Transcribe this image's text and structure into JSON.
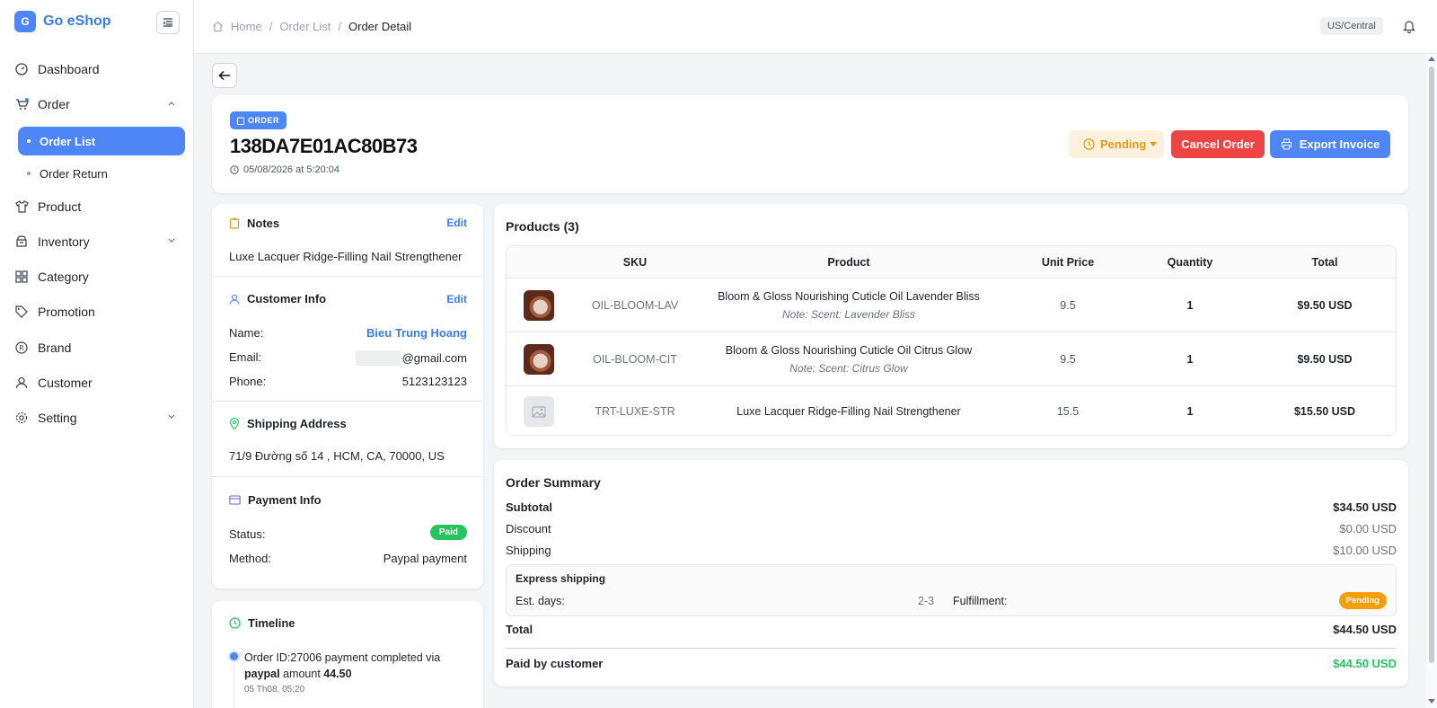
{
  "sidebar": {
    "logo_letter": "G",
    "brand_name": "Go eShop",
    "items": [
      {
        "label": "Dashboard",
        "icon": "dashboard-icon"
      },
      {
        "label": "Order",
        "icon": "cart-icon",
        "expanded": true
      },
      {
        "label": "Product",
        "icon": "shirt-icon"
      },
      {
        "label": "Inventory",
        "icon": "inventory-icon"
      },
      {
        "label": "Category",
        "icon": "grid-icon"
      },
      {
        "label": "Promotion",
        "icon": "tag-icon"
      },
      {
        "label": "Brand",
        "icon": "registered-icon"
      },
      {
        "label": "Customer",
        "icon": "user-icon"
      },
      {
        "label": "Setting",
        "icon": "gear-icon"
      }
    ],
    "order_sub": [
      {
        "label": "Order List",
        "active": true
      },
      {
        "label": "Order Return",
        "active": false
      }
    ]
  },
  "topbar": {
    "breadcrumb": [
      "Home",
      "Order List",
      "Order Detail"
    ],
    "timezone": "US/Central"
  },
  "order": {
    "badge": "ORDER",
    "id": "138DA7E01AC80B73",
    "date": "05/08/2026 at 5:20:04",
    "status": "Pending",
    "cancel_label": "Cancel Order",
    "export_label": "Export Invoice"
  },
  "notes": {
    "title": "Notes",
    "edit": "Edit",
    "text": "Luxe Lacquer Ridge-Filling Nail Strengthener"
  },
  "customer": {
    "title": "Customer Info",
    "edit": "Edit",
    "name_label": "Name:",
    "name": "Bieu Trung Hoang",
    "email_label": "Email:",
    "email": "@gmail.com",
    "phone_label": "Phone:",
    "phone": "5123123123"
  },
  "shipping": {
    "title": "Shipping Address",
    "address": "71/9 Đường số 14 , HCM, CA, 70000, US"
  },
  "payment": {
    "title": "Payment Info",
    "status_label": "Status:",
    "status": "Paid",
    "method_label": "Method:",
    "method": "Paypal payment"
  },
  "timeline": {
    "title": "Timeline",
    "event_prefix": "Order ID:27006 payment completed via",
    "event_method": "paypal",
    "event_amount_label": "amount",
    "event_amount": "44.50",
    "event_time": "05 Th08, 05:20"
  },
  "products": {
    "title": "Products (3)",
    "columns": [
      "SKU",
      "Product",
      "Unit Price",
      "Quantity",
      "Total"
    ],
    "rows": [
      {
        "sku": "OIL-BLOOM-LAV",
        "name": "Bloom & Gloss Nourishing Cuticle Oil Lavender Bliss",
        "note": "Note: Scent: Lavender Bliss",
        "price": "9.5",
        "qty": "1",
        "total": "$9.50 USD",
        "has_image": true
      },
      {
        "sku": "OIL-BLOOM-CIT",
        "name": "Bloom & Gloss Nourishing Cuticle Oil Citrus Glow",
        "note": "Note: Scent: Citrus Glow",
        "price": "9.5",
        "qty": "1",
        "total": "$9.50 USD",
        "has_image": true
      },
      {
        "sku": "TRT-LUXE-STR",
        "name": "Luxe Lacquer Ridge-Filling Nail Strengthener",
        "note": "",
        "price": "15.5",
        "qty": "1",
        "total": "$15.50 USD",
        "has_image": false
      }
    ]
  },
  "summary": {
    "title": "Order Summary",
    "subtotal_label": "Subtotal",
    "subtotal": "$34.50 USD",
    "discount_label": "Discount",
    "discount": "$0.00 USD",
    "shipping_label": "Shipping",
    "shipping": "$10.00 USD",
    "ship_method": "Express shipping",
    "est_label": "Est. days:",
    "est_days": "2-3",
    "fulfillment_label": "Fulfillment:",
    "fulfillment": "Pending",
    "total_label": "Total",
    "total": "$44.50 USD",
    "paid_label": "Paid by customer",
    "paid": "$44.50 USD"
  },
  "colors": {
    "primary": "#4f86f7",
    "danger": "#ef4444",
    "warning": "#f59e0b",
    "success": "#22c55e"
  }
}
